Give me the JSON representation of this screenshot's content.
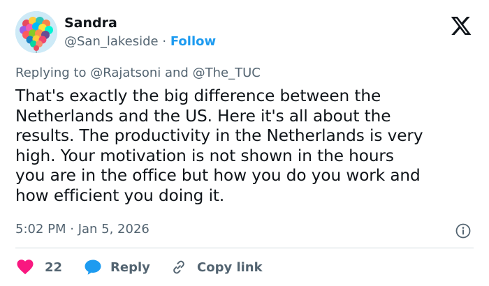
{
  "author": {
    "name": "Sandra",
    "handle": "@San_lakeside",
    "separator": "·",
    "follow_label": "Follow",
    "avatar_icon": "heart-balloons-avatar"
  },
  "platform": {
    "logo_icon": "x-logo-icon"
  },
  "reply_context": {
    "prefix": "Replying to",
    "mention_1": "@Rajatsoni",
    "conjunction": "and",
    "mention_2": "@The_TUC"
  },
  "tweet": {
    "text": "That's exactly the big difference between the\nNetherlands and the US.  Here it's all about the\nresults. The productivity in the Netherlands is very\nhigh. Your motivation is not shown in the hours\nyou are in the office but how you do you work and\nhow efficient you doing it.",
    "timestamp": "5:02 PM · Jan 5, 2026"
  },
  "actions": {
    "like_count": "22",
    "reply_label": "Reply",
    "copy_link_label": "Copy link"
  },
  "colors": {
    "accent": "#1d9bf0",
    "like": "#f91880",
    "muted_text": "#536471",
    "primary_text": "#0f1419",
    "divider": "#cfd9de"
  }
}
